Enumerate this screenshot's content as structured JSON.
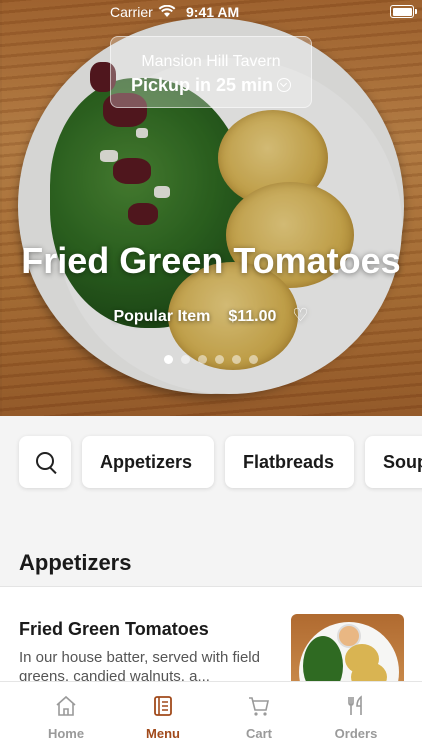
{
  "status_bar": {
    "carrier": "Carrier",
    "time": "9:41 AM"
  },
  "pickup": {
    "restaurant": "Mansion Hill Tavern",
    "eta": "Pickup in 25 min"
  },
  "hero": {
    "title": "Fried Green Tomatoes",
    "tag": "Popular Item",
    "price": "$11.00",
    "carousel": {
      "count": 6,
      "active_index": 1
    }
  },
  "categories": [
    "Appetizers",
    "Flatbreads",
    "Soups"
  ],
  "menu_section": {
    "title": "Appetizers",
    "items": [
      {
        "name": "Fried Green Tomatoes",
        "description": "In our house batter, served with field greens, candied walnuts, a..."
      }
    ]
  },
  "tabs": [
    {
      "label": "Home",
      "icon": "home-icon",
      "active": false
    },
    {
      "label": "Menu",
      "icon": "menu-book-icon",
      "active": true
    },
    {
      "label": "Cart",
      "icon": "cart-icon",
      "active": false
    },
    {
      "label": "Orders",
      "icon": "fork-knife-icon",
      "active": false
    }
  ],
  "colors": {
    "accent": "#a14a1b",
    "inactive_tab": "#9a9a9a",
    "background": "#f4f4f4"
  }
}
